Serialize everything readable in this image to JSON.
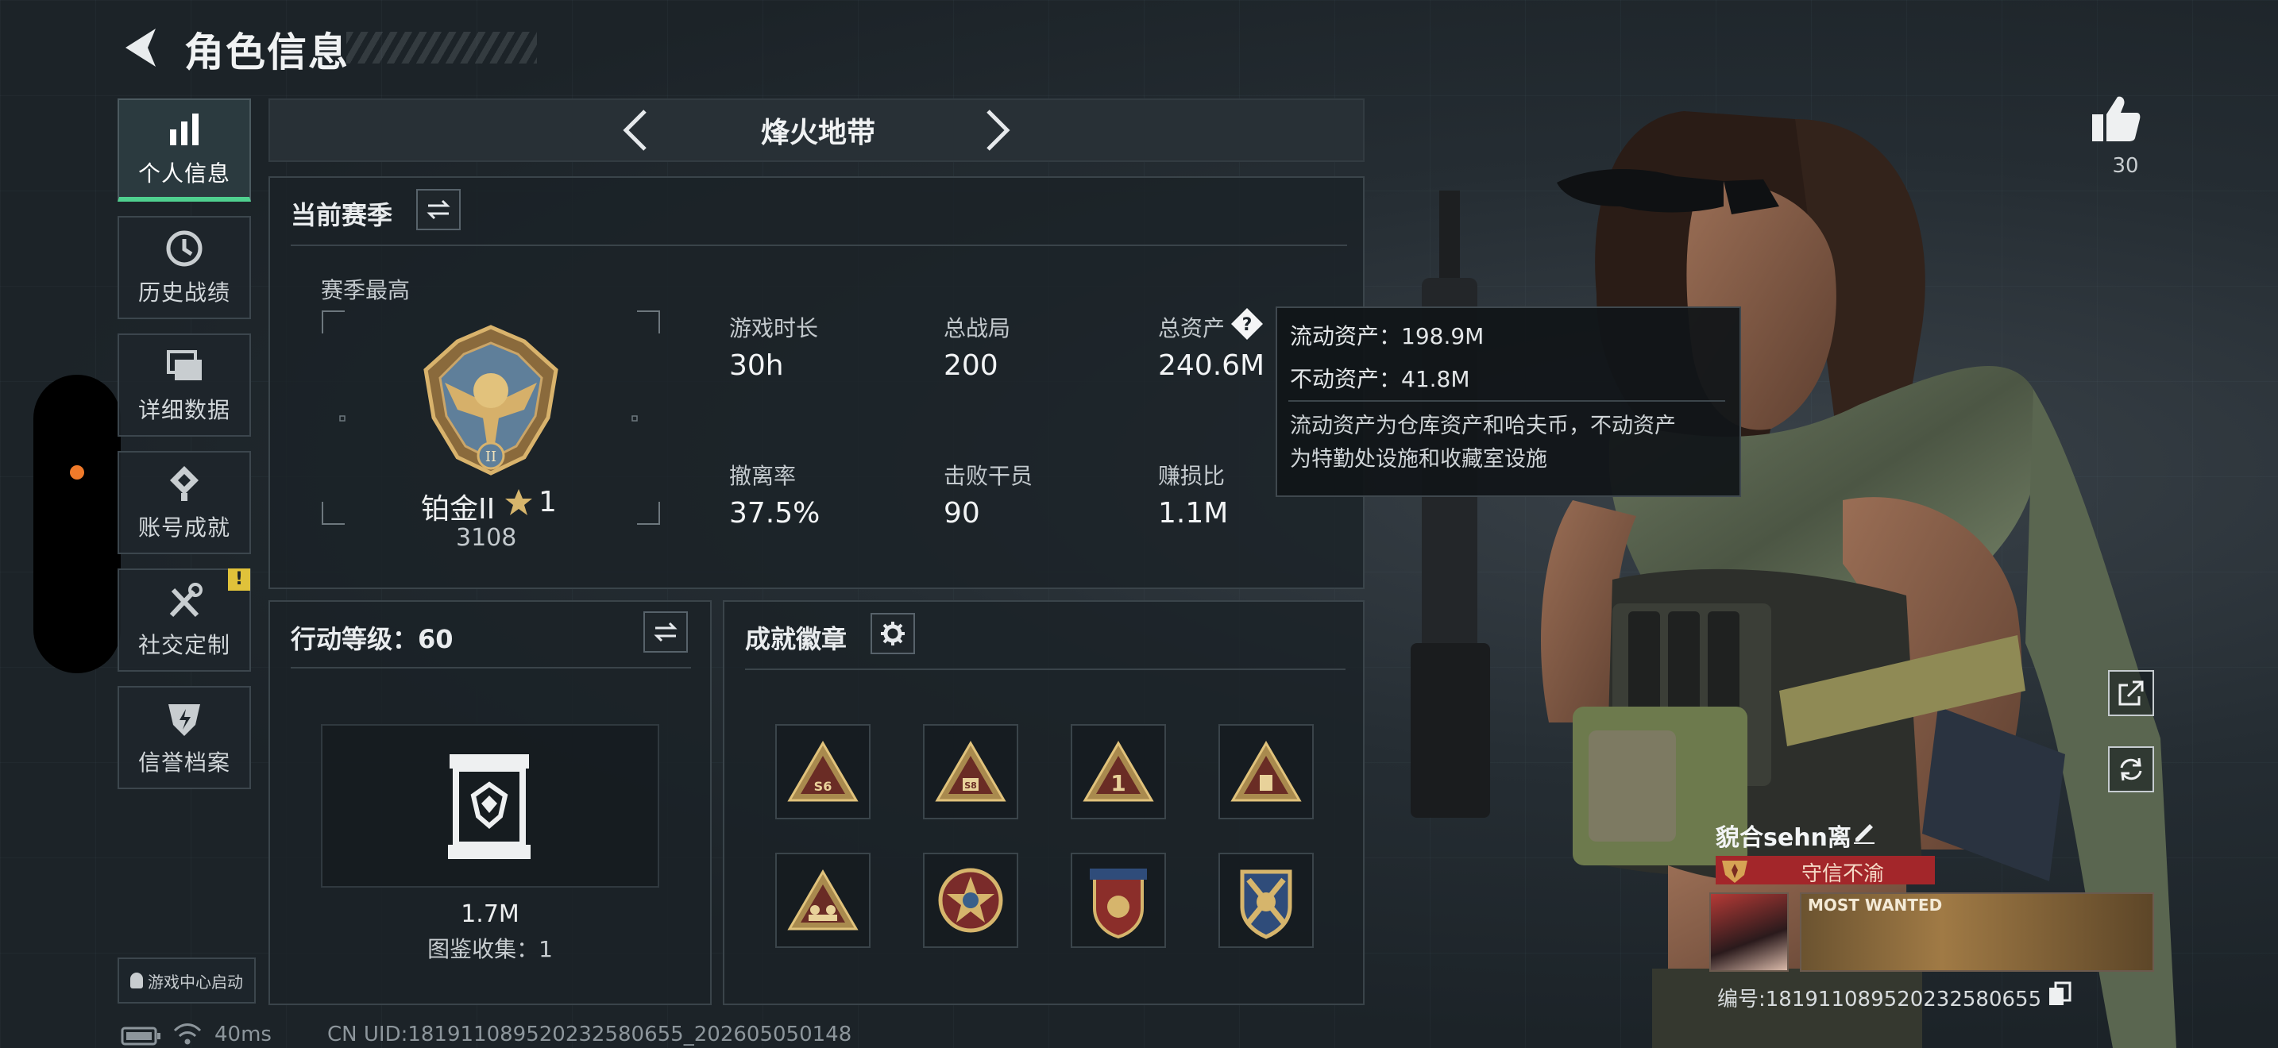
{
  "header": {
    "title": "角色信息"
  },
  "nav": {
    "items": [
      {
        "label": "个人信息",
        "icon": "bar-chart-icon",
        "active": true
      },
      {
        "label": "历史战绩",
        "icon": "history-clock-icon",
        "active": false
      },
      {
        "label": "详细数据",
        "icon": "folders-icon",
        "active": false
      },
      {
        "label": "账号成就",
        "icon": "achievement-icon",
        "active": false
      },
      {
        "label": "社交定制",
        "icon": "tools-icon",
        "active": false,
        "badge": "!"
      },
      {
        "label": "信誉档案",
        "icon": "credit-shield-icon",
        "active": false
      }
    ],
    "game_center_button": "游戏中心启动"
  },
  "mode": {
    "title": "烽火地带"
  },
  "season_panel": {
    "title": "当前赛季",
    "season_best_label": "赛季最高",
    "rank_name": "铂金II",
    "rank_stars": "1",
    "rank_score": "3108",
    "stats": [
      {
        "label": "游戏时长",
        "value": "30h"
      },
      {
        "label": "总战局",
        "value": "200"
      },
      {
        "label": "总资产",
        "value": "240.6M",
        "has_help": true
      },
      {
        "label": "撤离率",
        "value": "37.5%"
      },
      {
        "label": "击败干员",
        "value": "90"
      },
      {
        "label": "赚损比",
        "value": "1.1M"
      }
    ]
  },
  "tooltip": {
    "liquid_assets": "流动资产：198.9M",
    "fixed_assets": "不动资产：41.8M",
    "note_line1": "流动资产为仓库资产和哈夫币，不动资产",
    "note_line2": "为特勤处设施和收藏室设施"
  },
  "level_panel": {
    "title": "行动等级：60",
    "collection_value": "1.7M",
    "collection_label": "图鉴收集：1"
  },
  "badge_panel": {
    "title": "成就徽章",
    "badges": [
      "s6-triangle-badge-icon",
      "s8-triangle-badge-icon",
      "number-one-triangle-badge-icon",
      "supply-triangle-badge-icon",
      "team-triangle-badge-icon",
      "star-round-badge-icon",
      "stars-shield-badge-icon",
      "crossed-shield-badge-icon"
    ]
  },
  "social": {
    "like_count": "30"
  },
  "player": {
    "name": "貌合sehn离",
    "honor_tag": "守信不渝",
    "card_text": "MOST WANTED",
    "id": "编号:181911089520232580655"
  },
  "status_bar": {
    "ping": "40ms",
    "uid": "CN UID:181911089520232580655_202605050148"
  },
  "colors": {
    "accent_green": "#4fd08f",
    "honor_red": "#a3262a",
    "notification_yellow": "#e0c23a",
    "side_dot_orange": "#f07a2a"
  }
}
